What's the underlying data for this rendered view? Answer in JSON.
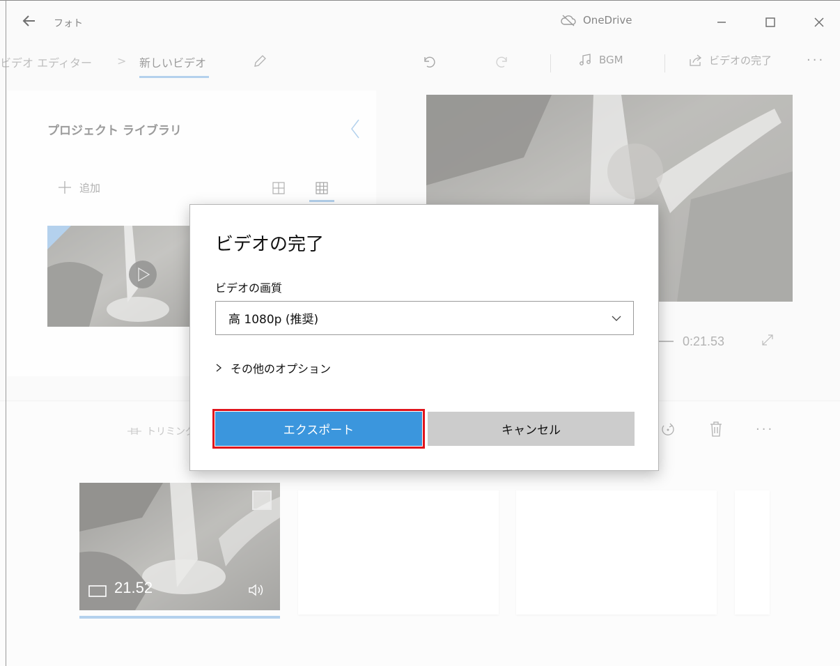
{
  "titlebar": {
    "back_icon": "back-arrow-icon",
    "app_title": "フォト",
    "cloud_label": "OneDrive",
    "minimize": "minimize-icon",
    "maximize": "maximize-icon",
    "close": "close-icon"
  },
  "command_bar": {
    "breadcrumb_root": "ビデオ エディター",
    "breadcrumb_sep": ">",
    "breadcrumb_current": "新しいビデオ",
    "bgm_label": "BGM",
    "finish_label": "ビデオの完了",
    "more_label": "···"
  },
  "library": {
    "title": "プロジェクト ライブラリ",
    "add_label": "追加"
  },
  "preview": {
    "time": "0:21.53"
  },
  "storyboard": {
    "trim_label": "トリミング",
    "more_label": "···",
    "clip_duration": "21.52"
  },
  "dialog": {
    "title": "ビデオの完了",
    "quality_label": "ビデオの画質",
    "quality_value": "高 1080p (推奨)",
    "more_options": "その他のオプション",
    "export_label": "エクスポート",
    "cancel_label": "キャンセル"
  },
  "colors": {
    "accent": "#3b96dd",
    "highlight": "#e0141c",
    "cancel_bg": "#cccccc",
    "underline": "#8cb9e3"
  }
}
